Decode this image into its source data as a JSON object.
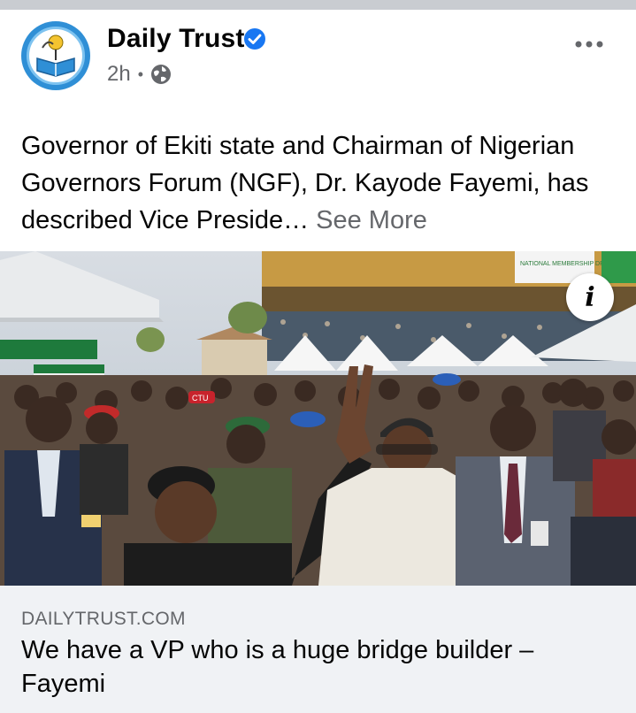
{
  "post": {
    "page_name": "Daily Trust",
    "verified_icon": "verified-badge-icon",
    "time": "2h",
    "separator": "•",
    "audience_icon": "globe-icon",
    "more_icon": "more-options-icon",
    "text": "Governor of Ekiti state and Chairman of Nigerian Governors Forum (NGF), Dr. Kayode Fayemi, has described Vice Preside…",
    "see_more": "See More"
  },
  "photo": {
    "description_icon": "info-icon",
    "info_label": "i",
    "sign_text": "NATIONAL MEMBERSHIP DRIVE",
    "cap_text": "CTU"
  },
  "link": {
    "domain": "DAILYTRUST.COM",
    "headline": "We have a VP who is a huge bridge builder – Fayemi"
  },
  "colors": {
    "brand_blue": "#1877f2",
    "text_primary": "#050505",
    "text_secondary": "#65676b",
    "card_bg": "#f0f2f5"
  }
}
